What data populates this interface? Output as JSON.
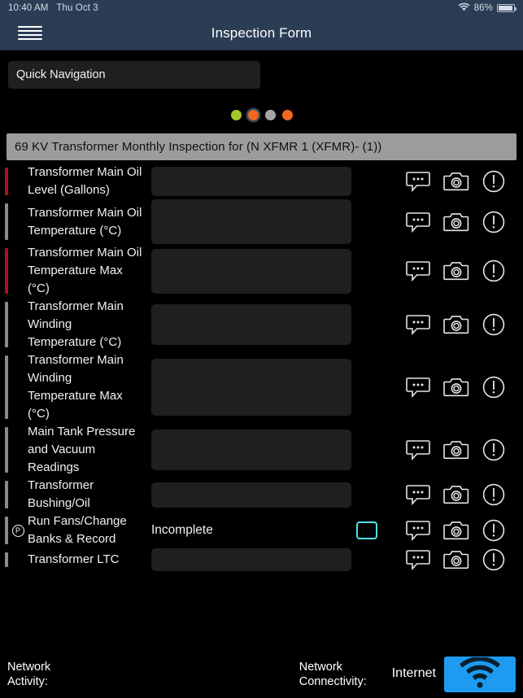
{
  "status_bar": {
    "time": "10:40 AM",
    "date": "Thu Oct 3",
    "battery_percent": "86%",
    "wifi_icon": "wifi-icon",
    "battery_icon": "battery-icon"
  },
  "navbar": {
    "menu_icon": "hamburger-menu-icon",
    "title": "Inspection Form"
  },
  "quick_navigation": {
    "label": "Quick Navigation"
  },
  "step_dots": [
    {
      "name": "dot-1",
      "color": "#a4c42a",
      "selected": false
    },
    {
      "name": "dot-2",
      "color": "#f26722",
      "selected": true
    },
    {
      "name": "dot-3",
      "color": "#a6a6a6",
      "selected": false
    },
    {
      "name": "dot-4",
      "color": "#f26722",
      "selected": false
    }
  ],
  "section": {
    "title": "69 KV Transformer Monthly Inspection for (N XFMR 1 (XFMR)- (1))"
  },
  "row_icons": {
    "comment": "comment-icon",
    "camera": "camera-icon",
    "alert": "alert-icon"
  },
  "rows": [
    {
      "label": "Transformer Main Oil Level (Gallons)",
      "flag_color": "#b01118",
      "badge": "",
      "field_type": "input",
      "value": "",
      "input_height": 36
    },
    {
      "label": "Transformer Main Oil Temperature (°C)",
      "flag_color": "#8a8a8a",
      "badge": "",
      "field_type": "input",
      "value": "",
      "input_height": 55
    },
    {
      "label": "Transformer Main Oil Temperature Max (°C)",
      "flag_color": "#b01118",
      "badge": "",
      "field_type": "input",
      "value": "",
      "input_height": 55
    },
    {
      "label": "Transformer Main Winding Temperature (°C)",
      "flag_color": "#8a8a8a",
      "badge": "",
      "field_type": "input",
      "value": "",
      "input_height": 50
    },
    {
      "label": "Transformer Main Winding Temperature Max (°C)",
      "flag_color": "#8a8a8a",
      "badge": "",
      "field_type": "input",
      "value": "",
      "input_height": 70
    },
    {
      "label": "Main Tank Pressure and Vacuum Readings",
      "flag_color": "#8a8a8a",
      "badge": "",
      "field_type": "input",
      "value": "",
      "input_height": 50
    },
    {
      "label": "Transformer Bushing/Oil",
      "flag_color": "#8a8a8a",
      "badge": "",
      "field_type": "input",
      "value": "",
      "input_height": 31
    },
    {
      "label": "Run Fans/Change Banks & Record",
      "flag_color": "#8a8a8a",
      "badge": "P",
      "field_type": "status",
      "value": "Incomplete",
      "checkbox": true,
      "input_height": 0
    },
    {
      "label": "Transformer LTC",
      "flag_color": "#8a8a8a",
      "badge": "",
      "field_type": "input",
      "value": "",
      "input_height": 28
    }
  ],
  "bottom_bar": {
    "network_activity_label": "Network\nActivity:",
    "network_connectivity_label": "Network\nConnectivity:",
    "internet_label": "Internet",
    "wifi_icon": "wifi-icon",
    "wifi_button_color": "#1e9bf0"
  }
}
